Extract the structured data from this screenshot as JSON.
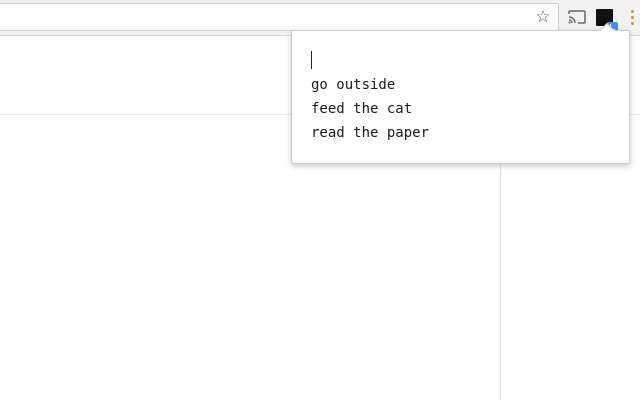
{
  "browser": {
    "address_bar": {
      "value": "",
      "placeholder": ""
    },
    "icons": {
      "bookmark": "star-icon",
      "cast": "cast-icon",
      "extension": "extension-icon",
      "menu": "kebab-menu-icon"
    },
    "colors": {
      "extension_badge": "#4a8df0",
      "menu_dots": "#c79a2b"
    }
  },
  "popup": {
    "input": {
      "value": "",
      "placeholder": ""
    },
    "todos": [
      {
        "text": "go outside"
      },
      {
        "text": "feed the cat"
      },
      {
        "text": "read the paper"
      }
    ]
  }
}
